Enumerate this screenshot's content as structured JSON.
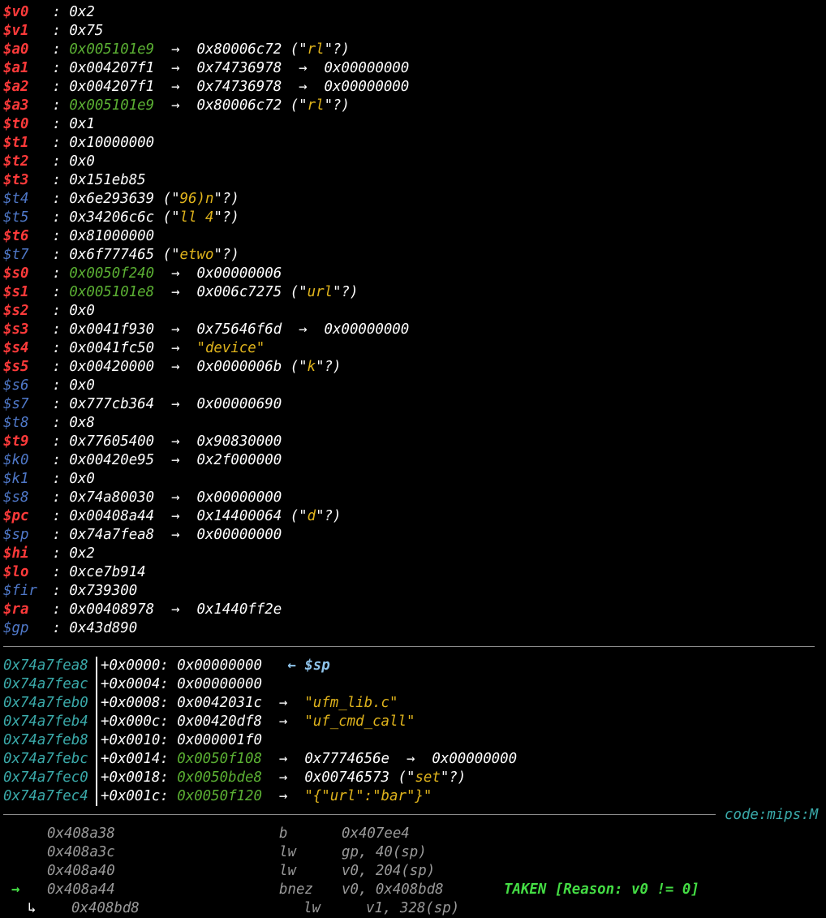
{
  "registers": [
    {
      "name": "$v0",
      "name_color": "red",
      "value": "0x2",
      "value_color": "white",
      "chain": []
    },
    {
      "name": "$v1",
      "name_color": "red",
      "value": "0x75",
      "value_color": "white",
      "chain": []
    },
    {
      "name": "$a0",
      "name_color": "red",
      "value": "0x005101e9",
      "value_color": "green",
      "chain": [
        {
          "value": "0x80006c72",
          "value_color": "white",
          "string": "rl",
          "string_style": "guess"
        }
      ]
    },
    {
      "name": "$a1",
      "name_color": "red",
      "value": "0x004207f1",
      "value_color": "white",
      "chain": [
        {
          "value": "0x74736978",
          "value_color": "white"
        },
        {
          "value": "0x00000000",
          "value_color": "white"
        }
      ]
    },
    {
      "name": "$a2",
      "name_color": "red",
      "value": "0x004207f1",
      "value_color": "white",
      "chain": [
        {
          "value": "0x74736978",
          "value_color": "white"
        },
        {
          "value": "0x00000000",
          "value_color": "white"
        }
      ]
    },
    {
      "name": "$a3",
      "name_color": "red",
      "value": "0x005101e9",
      "value_color": "green",
      "chain": [
        {
          "value": "0x80006c72",
          "value_color": "white",
          "string": "rl",
          "string_style": "guess"
        }
      ]
    },
    {
      "name": "$t0",
      "name_color": "red",
      "value": "0x1",
      "value_color": "white",
      "chain": []
    },
    {
      "name": "$t1",
      "name_color": "red",
      "value": "0x10000000",
      "value_color": "white",
      "chain": []
    },
    {
      "name": "$t2",
      "name_color": "red",
      "value": "0x0",
      "value_color": "white",
      "chain": []
    },
    {
      "name": "$t3",
      "name_color": "red",
      "value": "0x151eb85",
      "value_color": "white",
      "chain": []
    },
    {
      "name": "$t4",
      "name_color": "blue",
      "value": "0x6e293639",
      "value_color": "white",
      "string": "96)n",
      "string_style": "guess",
      "chain": []
    },
    {
      "name": "$t5",
      "name_color": "blue",
      "value": "0x34206c6c",
      "value_color": "white",
      "string": "ll 4",
      "string_style": "guess",
      "chain": []
    },
    {
      "name": "$t6",
      "name_color": "red",
      "value": "0x81000000",
      "value_color": "white",
      "chain": []
    },
    {
      "name": "$t7",
      "name_color": "blue",
      "value": "0x6f777465",
      "value_color": "white",
      "string": "etwo",
      "string_style": "guess",
      "chain": []
    },
    {
      "name": "$s0",
      "name_color": "red",
      "value": "0x0050f240",
      "value_color": "green",
      "chain": [
        {
          "value": "0x00000006",
          "value_color": "white"
        }
      ]
    },
    {
      "name": "$s1",
      "name_color": "red",
      "value": "0x005101e8",
      "value_color": "green",
      "chain": [
        {
          "value": "0x006c7275",
          "value_color": "white",
          "string": "url",
          "string_style": "guess"
        }
      ]
    },
    {
      "name": "$s2",
      "name_color": "red",
      "value": "0x0",
      "value_color": "white",
      "chain": []
    },
    {
      "name": "$s3",
      "name_color": "red",
      "value": "0x0041f930",
      "value_color": "white",
      "chain": [
        {
          "value": "0x75646f6d",
          "value_color": "white"
        },
        {
          "value": "0x00000000",
          "value_color": "white"
        }
      ]
    },
    {
      "name": "$s4",
      "name_color": "red",
      "value": "0x0041fc50",
      "value_color": "white",
      "chain": [
        {
          "value": "\"device\"",
          "value_color": "yellow"
        }
      ]
    },
    {
      "name": "$s5",
      "name_color": "red",
      "value": "0x00420000",
      "value_color": "white",
      "chain": [
        {
          "value": "0x0000006b",
          "value_color": "white",
          "string": "k",
          "string_style": "guess"
        }
      ]
    },
    {
      "name": "$s6",
      "name_color": "blue",
      "value": "0x0",
      "value_color": "white",
      "chain": []
    },
    {
      "name": "$s7",
      "name_color": "blue",
      "value": "0x777cb364",
      "value_color": "white",
      "chain": [
        {
          "value": "0x00000690",
          "value_color": "white"
        }
      ]
    },
    {
      "name": "$t8",
      "name_color": "blue",
      "value": "0x8",
      "value_color": "white",
      "chain": []
    },
    {
      "name": "$t9",
      "name_color": "red",
      "value": "0x77605400",
      "value_color": "white",
      "chain": [
        {
          "value": "0x90830000",
          "value_color": "white"
        }
      ]
    },
    {
      "name": "$k0",
      "name_color": "blue",
      "value": "0x00420e95",
      "value_color": "white",
      "chain": [
        {
          "value": "0x2f000000",
          "value_color": "white"
        }
      ]
    },
    {
      "name": "$k1",
      "name_color": "blue",
      "value": "0x0",
      "value_color": "white",
      "chain": []
    },
    {
      "name": "$s8",
      "name_color": "blue",
      "value": "0x74a80030",
      "value_color": "white",
      "chain": [
        {
          "value": "0x00000000",
          "value_color": "white"
        }
      ]
    },
    {
      "name": "$pc",
      "name_color": "red",
      "value": "0x00408a44",
      "value_color": "white",
      "chain": [
        {
          "value": "0x14400064",
          "value_color": "white",
          "string": "d",
          "string_style": "guess"
        }
      ]
    },
    {
      "name": "$sp",
      "name_color": "blue",
      "value": "0x74a7fea8",
      "value_color": "white",
      "chain": [
        {
          "value": "0x00000000",
          "value_color": "white"
        }
      ]
    },
    {
      "name": "$hi",
      "name_color": "red",
      "value": "0x2",
      "value_color": "white",
      "chain": []
    },
    {
      "name": "$lo",
      "name_color": "red",
      "value": "0xce7b914",
      "value_color": "white",
      "chain": []
    },
    {
      "name": "$fir",
      "name_color": "blue",
      "value": "0x739300",
      "value_color": "white",
      "chain": []
    },
    {
      "name": "$ra",
      "name_color": "red",
      "value": "0x00408978",
      "value_color": "white",
      "chain": [
        {
          "value": "0x1440ff2e",
          "value_color": "white"
        }
      ]
    },
    {
      "name": "$gp",
      "name_color": "blue",
      "value": "0x43d890",
      "value_color": "white",
      "chain": []
    }
  ],
  "stack": [
    {
      "addr": "0x74a7fea8",
      "offset": "+0x0000:",
      "value": "0x00000000",
      "value_color": "white",
      "chain": [],
      "tag": "← $sp"
    },
    {
      "addr": "0x74a7feac",
      "offset": "+0x0004:",
      "value": "0x00000000",
      "value_color": "white",
      "chain": []
    },
    {
      "addr": "0x74a7feb0",
      "offset": "+0x0008:",
      "value": "0x0042031c",
      "value_color": "white",
      "chain": [
        {
          "value": "\"ufm_lib.c\"",
          "value_color": "yellow"
        }
      ]
    },
    {
      "addr": "0x74a7feb4",
      "offset": "+0x000c:",
      "value": "0x00420df8",
      "value_color": "white",
      "chain": [
        {
          "value": "\"uf_cmd_call\"",
          "value_color": "yellow"
        }
      ]
    },
    {
      "addr": "0x74a7feb8",
      "offset": "+0x0010:",
      "value": "0x000001f0",
      "value_color": "white",
      "chain": []
    },
    {
      "addr": "0x74a7febc",
      "offset": "+0x0014:",
      "value": "0x0050f108",
      "value_color": "green",
      "chain": [
        {
          "value": "0x7774656e",
          "value_color": "white"
        },
        {
          "value": "0x00000000",
          "value_color": "white"
        }
      ]
    },
    {
      "addr": "0x74a7fec0",
      "offset": "+0x0018:",
      "value": "0x0050bde8",
      "value_color": "green",
      "chain": [
        {
          "value": "0x00746573",
          "value_color": "white",
          "string": "set",
          "string_style": "guess"
        }
      ]
    },
    {
      "addr": "0x74a7fec4",
      "offset": "+0x001c:",
      "value": "0x0050f120",
      "value_color": "green",
      "chain": [
        {
          "value": "\"{\"url\":\"bar\"}\"",
          "value_color": "yellow"
        }
      ]
    }
  ],
  "code_label": "code:mips:M",
  "code": [
    {
      "marker": "",
      "addr": "0x408a38",
      "mnem": "b",
      "ops": "0x407ee4",
      "note": "",
      "current": false
    },
    {
      "marker": "",
      "addr": "0x408a3c",
      "mnem": "lw",
      "ops": "gp, 40(sp)",
      "note": "",
      "current": false
    },
    {
      "marker": "",
      "addr": "0x408a40",
      "mnem": "lw",
      "ops": "v0, 204(sp)",
      "note": "",
      "current": false
    },
    {
      "marker": "→",
      "addr": "0x408a44",
      "mnem": "bnez",
      "ops": "v0, 0x408bd8",
      "note": "TAKEN [Reason: v0 != 0]",
      "current": true
    },
    {
      "marker": "↳",
      "addr": "0x408bd8",
      "mnem": "lw",
      "ops": "v1, 328(sp)",
      "note": "",
      "current": false
    }
  ],
  "colors": {
    "red": "#ff3a3a",
    "blue": "#4f78c8",
    "green": "#5bb033",
    "yellow": "#e0b41c",
    "cyan": "#3aaaaa",
    "white": "#ffffff",
    "gray": "#9a9a9a",
    "taken": "#44dd44"
  }
}
